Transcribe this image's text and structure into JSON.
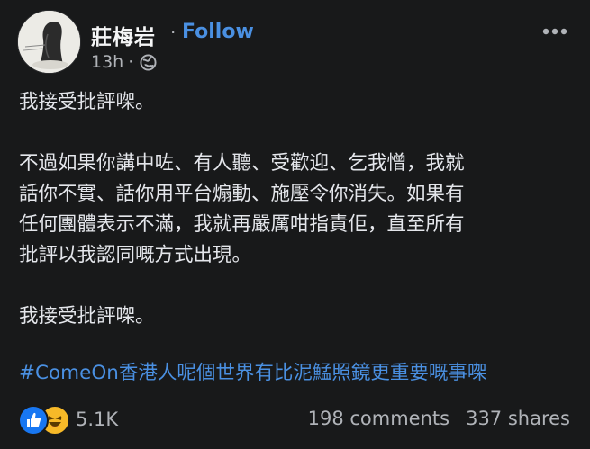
{
  "post": {
    "author_name": "莊梅岩",
    "separator_dot": "·",
    "follow_label": "Follow",
    "time_ago": "13h",
    "meta_dot": "·",
    "privacy_icon": "globe-icon",
    "more_icon": "more-horizontal-icon",
    "paragraphs": [
      [
        "我接受批評㗎。"
      ],
      [
        "不過如果你講中咗、有人聽、受歡迎、乞我憎，我就",
        "話你不實、話你用平台煽動、施壓令你消失。如果有",
        "任何團體表示不滿，我就再嚴厲咁指責佢，直至所有",
        "批評以我認同嘅方式出現。"
      ],
      [
        "我接受批評㗎。"
      ]
    ],
    "hashtag_text": "#ComeOn香港人呢個世界有比泥鯭照鏡更重要嘅事㗎",
    "reactions": {
      "icons": [
        "like-icon",
        "haha-icon"
      ],
      "count": "5.1K"
    },
    "comments": "198 comments",
    "shares": "337 shares",
    "colors": {
      "background": "#18191a",
      "text": "#e4e6eb",
      "muted": "#b0b3b8",
      "link": "#4a90e2",
      "like": "#1877f2",
      "haha": "#f7b928"
    }
  }
}
